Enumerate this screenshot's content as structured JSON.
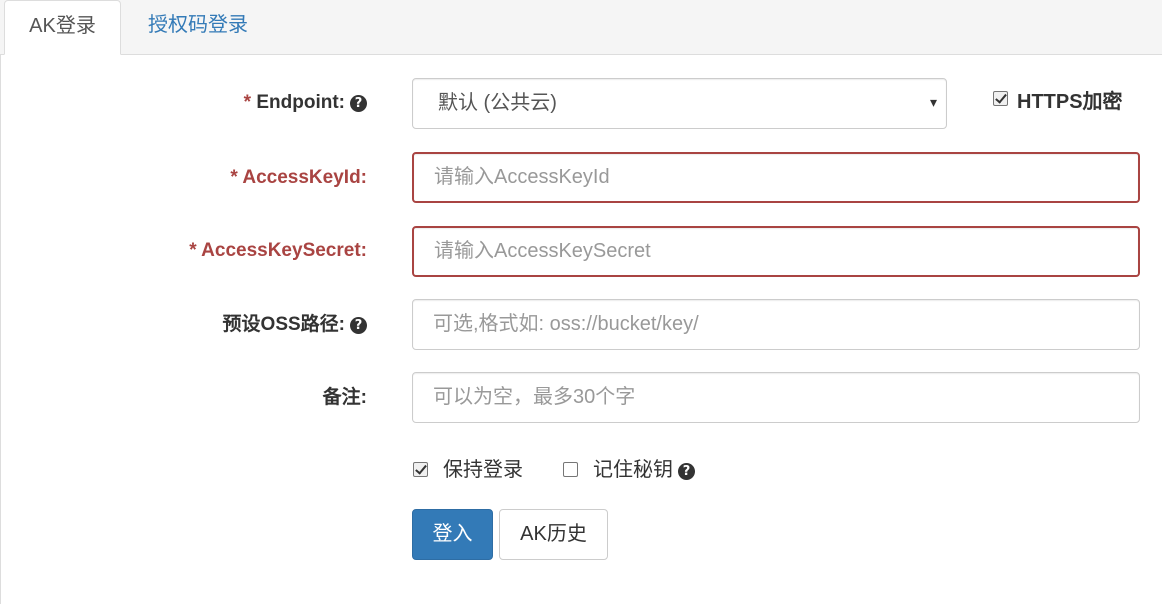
{
  "tabs": [
    {
      "label": "AK登录",
      "active": true
    },
    {
      "label": "授权码登录",
      "active": false
    }
  ],
  "form": {
    "endpoint": {
      "required_mark": "* ",
      "label": "Endpoint:",
      "help_icon": "question-circle-icon",
      "selected": "默认 (公共云)",
      "caret": "▾"
    },
    "https": {
      "label": "HTTPS加密",
      "checked": true
    },
    "access_key_id": {
      "required_mark": "* ",
      "label": "AccessKeyId:",
      "placeholder": "请输入AccessKeyId",
      "value": ""
    },
    "access_key_secret": {
      "required_mark": "* ",
      "label": "AccessKeySecret:",
      "placeholder": "请输入AccessKeySecret",
      "value": ""
    },
    "oss_path": {
      "label": "预设OSS路径:",
      "help_icon": "question-circle-icon",
      "placeholder": "可选,格式如: oss://bucket/key/",
      "value": ""
    },
    "note": {
      "label": "备注:",
      "placeholder": "可以为空，最多30个字",
      "value": ""
    },
    "keep_login": {
      "label": "保持登录",
      "checked": true
    },
    "remember_secret": {
      "label": "记住秘钥",
      "checked": false,
      "help_icon": "question-circle-icon"
    },
    "login_button": "登入",
    "history_button": "AK历史"
  },
  "colors": {
    "primary": "#337ab7",
    "error": "#a94442",
    "link": "#337ab7"
  }
}
